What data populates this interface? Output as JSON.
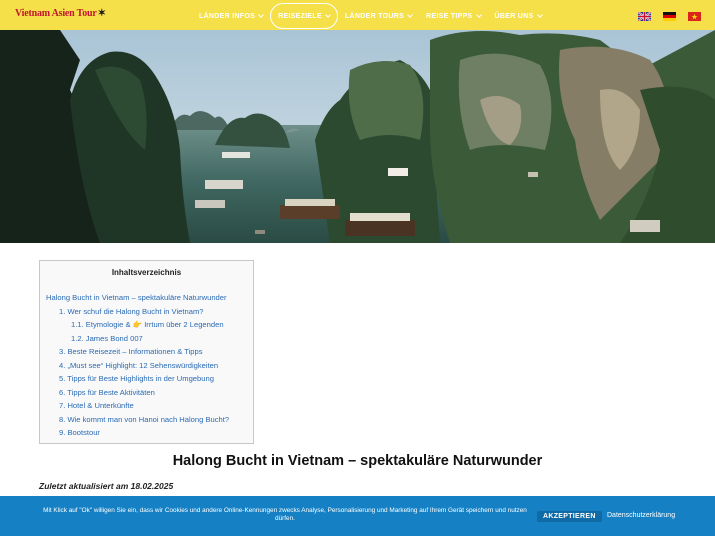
{
  "header": {
    "logo_text": "Vietnam Asien Tour",
    "nav": [
      {
        "label": "LÄNDER INFOS",
        "active": false
      },
      {
        "label": "REISEZIELE",
        "active": true
      },
      {
        "label": "LÄNDER TOURS",
        "active": false
      },
      {
        "label": "REISE TIPPS",
        "active": false
      },
      {
        "label": "ÜBER UNS",
        "active": false
      }
    ],
    "flags": [
      "uk-flag-icon",
      "germany-flag-icon",
      "vietnam-flag-icon"
    ]
  },
  "toc": {
    "title": "Inhaltsverzeichnis",
    "items": [
      {
        "level": 0,
        "text": "Halong Bucht in Vietnam – spektakuläre Naturwunder"
      },
      {
        "level": 1,
        "text": "1. Wer schuf die Halong Bucht in Vietnam?"
      },
      {
        "level": 2,
        "text": "1.1. Etymologie & 👉 Irrtum über 2 Legenden"
      },
      {
        "level": 2,
        "text": "1.2. James Bond 007"
      },
      {
        "level": 1,
        "text": "3. Beste Reisezeit – Informationen & Tipps"
      },
      {
        "level": 1,
        "text": "4. „Must see“ Highlight: 12 Sehenswürdigkeiten"
      },
      {
        "level": 1,
        "text": "5. Tipps für Beste Highlights in der Umgebung"
      },
      {
        "level": 1,
        "text": "6. Tipps für Beste Aktivitäten"
      },
      {
        "level": 1,
        "text": "7. Hotel & Unterkünfte"
      },
      {
        "level": 1,
        "text": "8. Wie kommt man von Hanoi nach Halong Bucht?"
      },
      {
        "level": 1,
        "text": "9. Bootstour"
      }
    ]
  },
  "article": {
    "title": "Halong Bucht in Vietnam – spektakuläre Naturwunder",
    "updated": "Zuletzt aktualisiert am 18.02.2025"
  },
  "cookie": {
    "text": "Mit Klick auf \"Ok\" willigen Sie ein, dass wir Cookies und andere Online-Kennungen zwecks Analyse, Personalisierung und Marketing auf Ihrem Gerät speichern und nutzen dürfen.",
    "accept_label": "AKZEPTIEREN",
    "privacy_label": "Datenschutzerklärung"
  },
  "colors": {
    "header_bg": "#f6e04a",
    "logo": "#c0172d",
    "link": "#2a6bb5",
    "cookie_bg": "#1580c4"
  }
}
